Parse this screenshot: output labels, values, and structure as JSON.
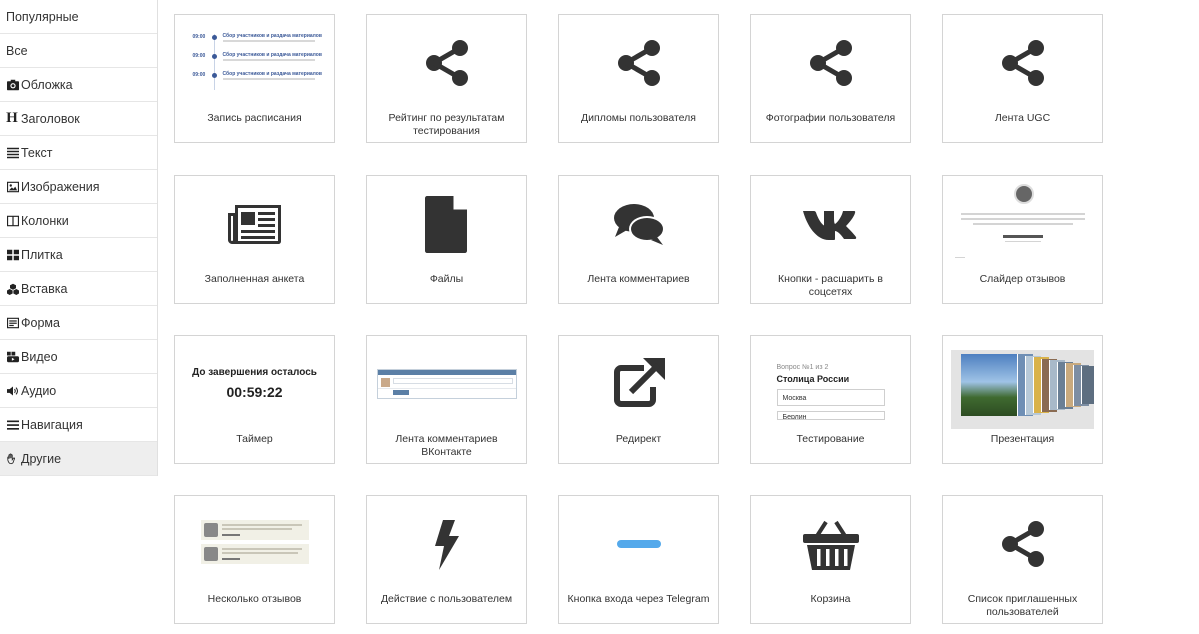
{
  "sidebar": {
    "items": [
      {
        "label": "Популярные",
        "icon": ""
      },
      {
        "label": "Все",
        "icon": ""
      },
      {
        "label": "Обложка",
        "icon": "camera-icon"
      },
      {
        "label": "Заголовок",
        "icon": "heading-icon"
      },
      {
        "label": "Текст",
        "icon": "align-justify-icon"
      },
      {
        "label": "Изображения",
        "icon": "image-icon"
      },
      {
        "label": "Колонки",
        "icon": "columns-icon"
      },
      {
        "label": "Плитка",
        "icon": "th-large-icon"
      },
      {
        "label": "Вставка",
        "icon": "cubes-icon"
      },
      {
        "label": "Форма",
        "icon": "form-icon"
      },
      {
        "label": "Видео",
        "icon": "youtube-icon"
      },
      {
        "label": "Аудио",
        "icon": "volume-icon"
      },
      {
        "label": "Навигация",
        "icon": "bars-icon"
      },
      {
        "label": "Другие",
        "icon": "hand-icon"
      }
    ],
    "active_index": 13,
    "heading_glyph": "H"
  },
  "tiles": [
    {
      "label": "Запись расписания",
      "preview": "schedule"
    },
    {
      "label": "Рейтинг по результатам тестирования",
      "preview": "share-icon"
    },
    {
      "label": "Дипломы пользователя",
      "preview": "share-icon"
    },
    {
      "label": "Фотографии пользователя",
      "preview": "share-icon"
    },
    {
      "label": "Лента UGC",
      "preview": "share-icon"
    },
    {
      "label": "Заполненная анкета",
      "preview": "newspaper-icon"
    },
    {
      "label": "Файлы",
      "preview": "file-icon"
    },
    {
      "label": "Лента комментариев",
      "preview": "comments-icon"
    },
    {
      "label": "Кнопки - расшарить в соцсетях",
      "preview": "vk-icon"
    },
    {
      "label": "Слайдер отзывов",
      "preview": "review-slider"
    },
    {
      "label": "Таймер",
      "preview": "timer"
    },
    {
      "label": "Лента комментариев ВКонтакте",
      "preview": "vk-comments"
    },
    {
      "label": "Редирект",
      "preview": "external-link-icon"
    },
    {
      "label": "Тестирование",
      "preview": "quiz"
    },
    {
      "label": "Презентация",
      "preview": "presentation"
    },
    {
      "label": "Несколько отзывов",
      "preview": "reviews"
    },
    {
      "label": "Действие с пользователем",
      "preview": "bolt-icon"
    },
    {
      "label": "Кнопка входа через Telegram",
      "preview": "telegram-button"
    },
    {
      "label": "Корзина",
      "preview": "basket-icon"
    },
    {
      "label": "Список приглашенных пользователей",
      "preview": "share-icon"
    }
  ],
  "timer": {
    "caption": "До завершения осталось",
    "time": "00:59:22"
  },
  "quiz": {
    "question_number": "Вопрос №1 из 2",
    "question": "Столица России",
    "options": [
      "Москва",
      "Берлин"
    ]
  },
  "schedule": {
    "rows": [
      {
        "time": "09:00",
        "title": "Сбор участников и раздача материалов"
      },
      {
        "time": "09:00",
        "title": "Сбор участников и раздача материалов"
      },
      {
        "time": "09:00",
        "title": "Сбор участников и раздача материалов"
      }
    ]
  },
  "colors": {
    "icon": "#333333",
    "border": "#d4d4d4",
    "active_bg": "#eeeeee",
    "telegram": "#54a9eb",
    "vk_blue": "#5b7fa6"
  }
}
